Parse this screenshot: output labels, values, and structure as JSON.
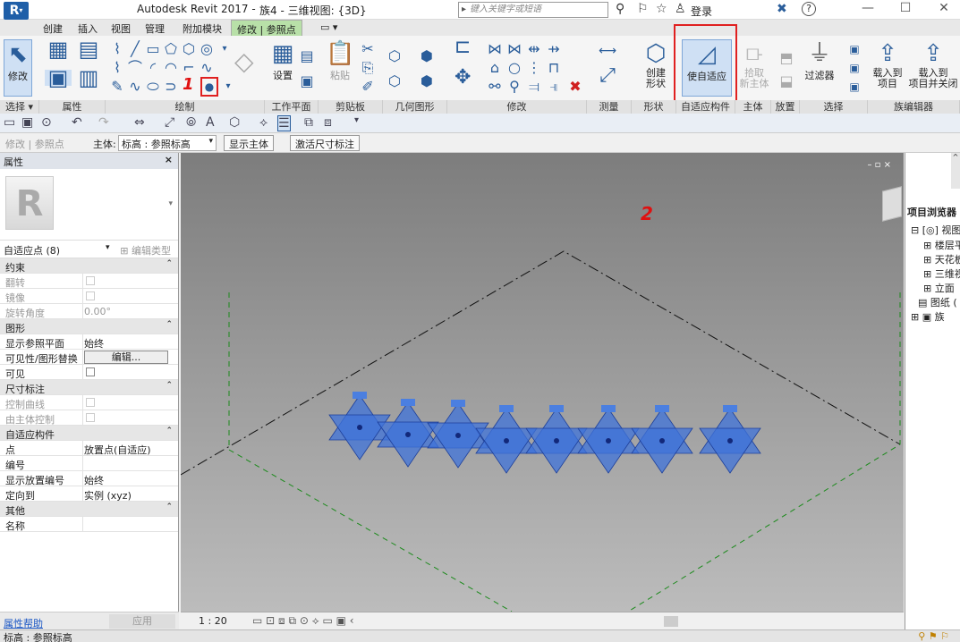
{
  "titlebar": {
    "app_title": "Autodesk Revit 2017 -",
    "doc_title": "族4 - 三维视图: {3D}",
    "search_placeholder": "键入关键字或短语",
    "login": "登录",
    "help": "?"
  },
  "ribbon_tabs": [
    "创建",
    "插入",
    "视图",
    "管理",
    "附加模块",
    "修改 | 参照点"
  ],
  "ribbon": {
    "modify": "修改",
    "settings": "设置",
    "paste": "粘贴",
    "create_form": "创建\n形状",
    "make_adaptive": "使自适应",
    "pick_host": "拾取\n新主体",
    "filter": "过滤器",
    "load_project": "载入到\n项目",
    "load_close": "载入到\n项目并关闭",
    "panels": [
      "选择 ▾",
      "属性",
      "绘制",
      "工作平面",
      "剪贴板",
      "几何图形",
      "修改",
      "测量",
      "形状",
      "自适应构件",
      "主体",
      "放置",
      "选择",
      "族编辑器"
    ]
  },
  "annotations": {
    "one": "1",
    "two": "2"
  },
  "options_bar": {
    "context": "修改 | 参照点",
    "host_label": "主体:",
    "host_value": "标高 : 参照标高",
    "show_host": "显示主体",
    "activate_dim": "激活尺寸标注"
  },
  "properties": {
    "title": "属性",
    "type_selector": "自适应点 (8)",
    "edit_type": "编辑类型",
    "rows": [
      {
        "k": "约束",
        "group": true
      },
      {
        "k": "翻转",
        "grey": true,
        "check": true
      },
      {
        "k": "镜像",
        "grey": true,
        "check": true
      },
      {
        "k": "旋转角度",
        "v": "0.00°",
        "grey": true
      },
      {
        "k": "图形",
        "group": true
      },
      {
        "k": "显示参照平面",
        "v": "始终"
      },
      {
        "k": "可见性/图形替换",
        "btn": "编辑..."
      },
      {
        "k": "可见",
        "check": true
      },
      {
        "k": "尺寸标注",
        "group": true
      },
      {
        "k": "控制曲线",
        "grey": true,
        "check": true
      },
      {
        "k": "由主体控制",
        "grey": true,
        "check": true
      },
      {
        "k": "自适应构件",
        "group": true
      },
      {
        "k": "点",
        "v": "放置点(自适应)"
      },
      {
        "k": "编号",
        "v": ""
      },
      {
        "k": "显示放置编号",
        "v": "始终"
      },
      {
        "k": "定向到",
        "v": "实例 (xyz)"
      },
      {
        "k": "其他",
        "group": true
      },
      {
        "k": "名称",
        "v": ""
      }
    ],
    "help": "属性帮助",
    "apply": "应用"
  },
  "view_bar": {
    "scale": "1 : 20"
  },
  "browser": {
    "title": "项目浏览器",
    "items": [
      "视图 (",
      "楼层平",
      "天花板",
      "三维视",
      "立面",
      "图纸 (",
      "族"
    ]
  },
  "status": "标高 : 参照标高",
  "colors": {
    "accent": "#2a5d9a",
    "highlight": "#e02020",
    "point_fill": "#3f73d9"
  }
}
